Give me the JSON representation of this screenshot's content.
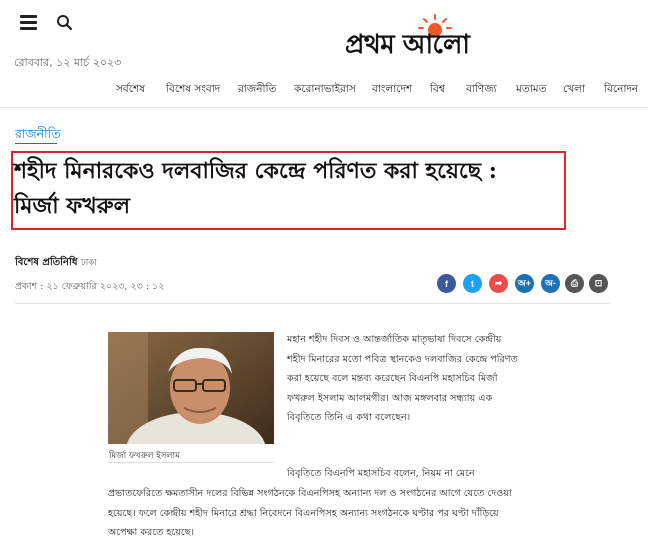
{
  "header": {
    "date": "রোববার, ১২ মার্চ ২০২৩",
    "logo_text": "প্রথম আলো"
  },
  "nav": {
    "items": [
      "সর্বশেষ",
      "বিশেষ সংবাদ",
      "রাজনীতি",
      "করোনাভাইরাস",
      "বাংলাদেশ",
      "বিশ্ব",
      "বাণিজ্য",
      "মতামত",
      "খেলা",
      "বিনোদন"
    ]
  },
  "article": {
    "section": "রাজনীতি",
    "headline_line1": "শহীদ মিনারকেও দলবাজির কেন্দ্রে পরিণত করা হয়েছে :",
    "headline_line2": "মির্জা ফখরুল",
    "byline": "বিশেষ প্রতিনিধি",
    "byline_location": "ঢাকা",
    "published": "প্রকাশ : ২১ ফেব্রুয়ারি ২০২৩, ২৩ : ১২",
    "photo_caption": "মির্জা ফখরুল ইসলাম",
    "paragraph1": "মহান শহীদ দিবস ও আন্তর্জাতিক মাতৃভাষা দিবসে কেন্দ্রীয় শহীদ মিনারের মতো পবিত্র স্থানকেও দলবাজির কেন্দ্রে পরিণত করা হয়েছে বলে মন্তব্য করেছেন বিএনপি মহাসচিব মির্জা ফখরুল ইসলাম আলমগীর। আজ মঙ্গলবার সন্ধ্যায় এক বিবৃতিতে তিনি এ কথা বলেছেন।",
    "paragraph2_line1": "বিবৃতিতে বিএনপি মহাসচিব বলেন, নিয়ম না মেনে",
    "paragraph2_rest": "প্রভাতফেরিতে ক্ষমতাসীন দলের বিভিন্ন সংগঠনকে বিএনপিসহ অন্যান্য দল ও সংগঠনের আগে যেতে দেওয়া হয়েছে। ফলে কেন্দ্রীয় শহীদ মিনারে শ্রদ্ধা নিবেদনে বিএনপিসহ অন্যান্য সংগঠনকে ঘণ্টার পর ঘণ্টা দাঁড়িয়ে অপেক্ষা করতে হয়েছে।"
  },
  "share": {
    "buttons": [
      {
        "name": "facebook",
        "color": "#3b5998",
        "glyph": "f"
      },
      {
        "name": "twitter",
        "color": "#1da1f2",
        "glyph": "t"
      },
      {
        "name": "share",
        "color": "#eb4d4d",
        "glyph": "➦"
      },
      {
        "name": "font-increase",
        "color": "#1a73b6",
        "glyph": "অ+"
      },
      {
        "name": "font-decrease",
        "color": "#1a73b6",
        "glyph": "অ-"
      },
      {
        "name": "print",
        "color": "#555555",
        "glyph": "⎙"
      },
      {
        "name": "bookmark",
        "color": "#555555",
        "glyph": "⊡"
      }
    ]
  },
  "colors": {
    "accent": "#1a73b6",
    "highlight_box": "#e3232c",
    "logo_sun": "#f05a28"
  }
}
